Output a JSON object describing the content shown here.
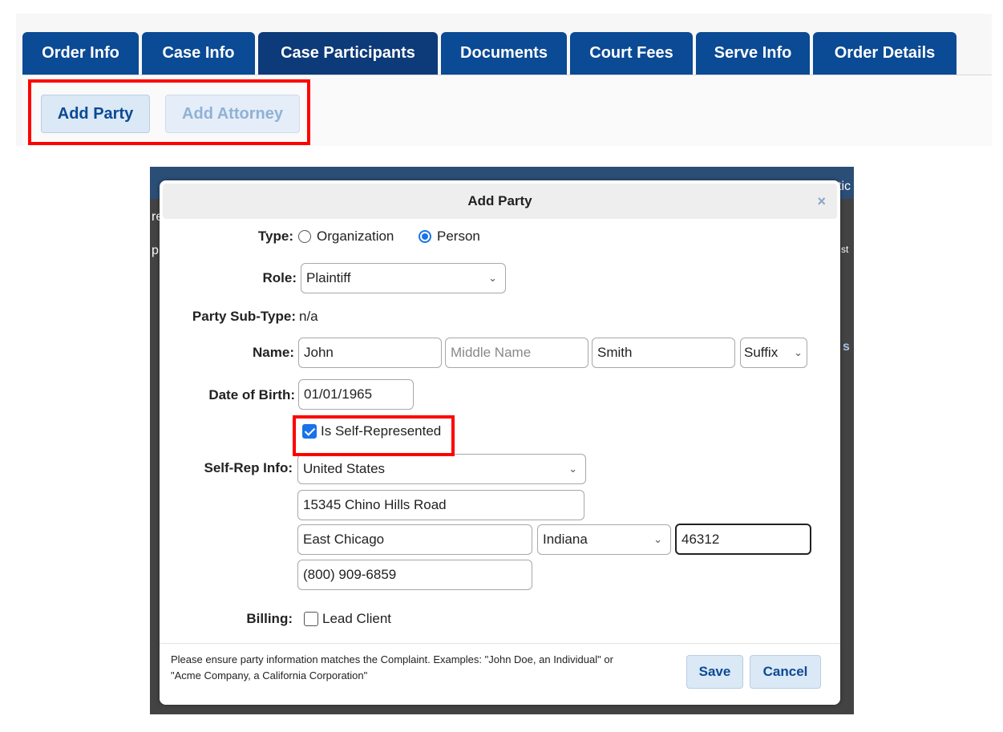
{
  "tabs": [
    {
      "label": "Order Info",
      "active": false
    },
    {
      "label": "Case Info",
      "active": false
    },
    {
      "label": "Case Participants",
      "active": true
    },
    {
      "label": "Documents",
      "active": false
    },
    {
      "label": "Court Fees",
      "active": false
    },
    {
      "label": "Serve Info",
      "active": false
    },
    {
      "label": "Order Details",
      "active": false
    }
  ],
  "toolbar": {
    "add_party_label": "Add Party",
    "add_attorney_label": "Add Attorney",
    "add_attorney_disabled": true
  },
  "modal": {
    "title": "Add Party",
    "close_glyph": "×",
    "type": {
      "label": "Type:",
      "options": [
        "Organization",
        "Person"
      ],
      "selected": "Person"
    },
    "role": {
      "label": "Role:",
      "value": "Plaintiff"
    },
    "sub_type": {
      "label": "Party Sub-Type:",
      "value": "n/a"
    },
    "name": {
      "label": "Name:",
      "first": "John",
      "middle_placeholder": "Middle Name",
      "last": "Smith",
      "suffix": "Suffix"
    },
    "dob": {
      "label": "Date of Birth:",
      "value": "01/01/1965"
    },
    "self_rep_checkbox": {
      "label": "Is Self-Represented",
      "checked": true
    },
    "self_rep": {
      "label": "Self-Rep Info:",
      "country": "United States",
      "address": "15345 Chino Hills Road",
      "city": "East Chicago",
      "state": "Indiana",
      "zip": "46312",
      "phone": "(800) 909-6859"
    },
    "billing": {
      "label": "Billing:",
      "checkbox_label": "Lead Client",
      "checked": false
    },
    "footer_note": "Please ensure party information matches the Complaint. Examples: \"John Doe, an Individual\" or \"Acme Company, a California Corporation\"",
    "save_label": "Save",
    "cancel_label": "Cancel"
  },
  "background_fragments": [
    "re",
    "p",
    "st",
    "tic",
    "s"
  ],
  "colors": {
    "tab_bg": "#0b4a94",
    "tab_active_bg": "#0d3a78",
    "button_bg": "#dbe8f6",
    "button_text": "#0b4a94",
    "highlight": "#ff0000",
    "radio_checked": "#1a73e8"
  }
}
